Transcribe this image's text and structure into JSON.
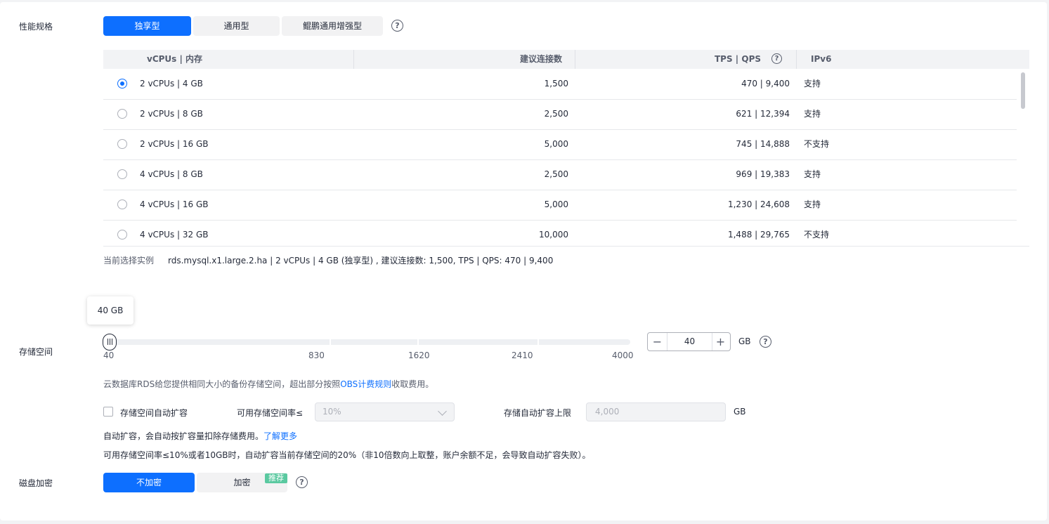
{
  "spec": {
    "label": "性能规格",
    "types": [
      "独享型",
      "通用型",
      "鲲鹏通用增强型"
    ],
    "active_type": "独享型"
  },
  "table": {
    "headers": {
      "vcpu_mem": "vCPUs | 内存",
      "connections": "建议连接数",
      "tps_qps": "TPS | QPS",
      "ipv6": "IPv6"
    },
    "rows": [
      {
        "spec": "2 vCPUs | 4 GB",
        "connections": "1,500",
        "tps_qps": "470 | 9,400",
        "ipv6": "支持",
        "selected": true
      },
      {
        "spec": "2 vCPUs | 8 GB",
        "connections": "2,500",
        "tps_qps": "621 | 12,394",
        "ipv6": "支持",
        "selected": false
      },
      {
        "spec": "2 vCPUs | 16 GB",
        "connections": "5,000",
        "tps_qps": "745 | 14,888",
        "ipv6": "不支持",
        "selected": false
      },
      {
        "spec": "4 vCPUs | 8 GB",
        "connections": "2,500",
        "tps_qps": "969 | 19,383",
        "ipv6": "支持",
        "selected": false
      },
      {
        "spec": "4 vCPUs | 16 GB",
        "connections": "5,000",
        "tps_qps": "1,230 | 24,608",
        "ipv6": "支持",
        "selected": false
      },
      {
        "spec": "4 vCPUs | 32 GB",
        "connections": "10,000",
        "tps_qps": "1,488 | 29,765",
        "ipv6": "不支持",
        "selected": false
      }
    ]
  },
  "current": {
    "label": "当前选择实例",
    "value": "rds.mysql.x1.large.2.ha | 2 vCPUs | 4 GB (独享型) , 建议连接数: 1,500, TPS | QPS: 470 | 9,400"
  },
  "storage": {
    "label": "存储空间",
    "tooltip": "40 GB",
    "ticks": [
      "40",
      "830",
      "1620",
      "2410",
      "4000"
    ],
    "value": "40",
    "unit": "GB",
    "minus": "−",
    "plus": "+",
    "note_prefix": "云数据库RDS给您提供相同大小的备份存储空间，超出部分按照",
    "note_link": "OBS计费规则",
    "note_suffix": "收取费用。"
  },
  "autoscale": {
    "checkbox_label": "存储空间自动扩容",
    "ratio_label": "可用存储空间率≤",
    "ratio_value": "10%",
    "limit_label": "存储自动扩容上限",
    "limit_value": "4,000",
    "limit_unit": "GB",
    "note1_text": "自动扩容，会自动按扩容量扣除存储费用。",
    "note1_link": "了解更多",
    "note2": "可用存储空间率≤10%或者10GB时，自动扩容当前存储空间的20%（非10倍数向上取整，账户余额不足，会导致自动扩容失败）。"
  },
  "encryption": {
    "label": "磁盘加密",
    "options": [
      "不加密",
      "加密"
    ],
    "badge": "推荐"
  },
  "colors": {
    "accent": "#0d6fff",
    "badge": "#5ac9a0"
  }
}
